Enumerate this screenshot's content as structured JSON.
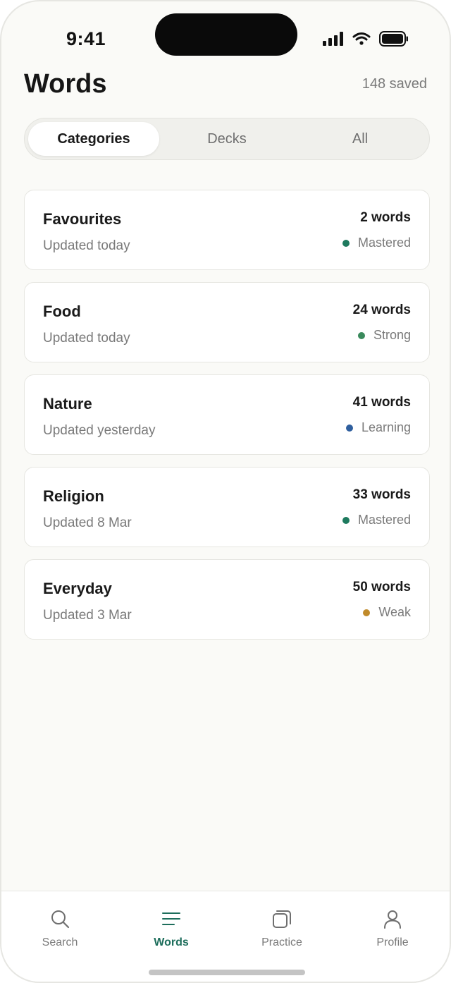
{
  "status_bar": {
    "time": "9:41"
  },
  "header": {
    "title": "Words",
    "saved_count": "148 saved"
  },
  "segments": [
    {
      "label": "Categories",
      "active": true
    },
    {
      "label": "Decks",
      "active": false
    },
    {
      "label": "All",
      "active": false
    }
  ],
  "categories": [
    {
      "title": "Favourites",
      "updated": "Updated today",
      "count": "2 words",
      "status": "Mastered",
      "status_color": "#1e7a5e"
    },
    {
      "title": "Food",
      "updated": "Updated today",
      "count": "24 words",
      "status": "Strong",
      "status_color": "#3a8a5c"
    },
    {
      "title": "Nature",
      "updated": "Updated yesterday",
      "count": "41 words",
      "status": "Learning",
      "status_color": "#2f5f9e"
    },
    {
      "title": "Religion",
      "updated": "Updated 8 Mar",
      "count": "33 words",
      "status": "Mastered",
      "status_color": "#1e7a5e"
    },
    {
      "title": "Everyday",
      "updated": "Updated 3 Mar",
      "count": "50 words",
      "status": "Weak",
      "status_color": "#c08a2a"
    }
  ],
  "tab_bar": {
    "items": [
      {
        "label": "Search",
        "icon": "search-icon",
        "active": false
      },
      {
        "label": "Words",
        "icon": "list-icon",
        "active": true
      },
      {
        "label": "Practice",
        "icon": "cards-icon",
        "active": false
      },
      {
        "label": "Profile",
        "icon": "person-icon",
        "active": false
      }
    ]
  },
  "colors": {
    "accent": "#1e6e5c",
    "background": "#fafaf7",
    "card": "#ffffff"
  }
}
